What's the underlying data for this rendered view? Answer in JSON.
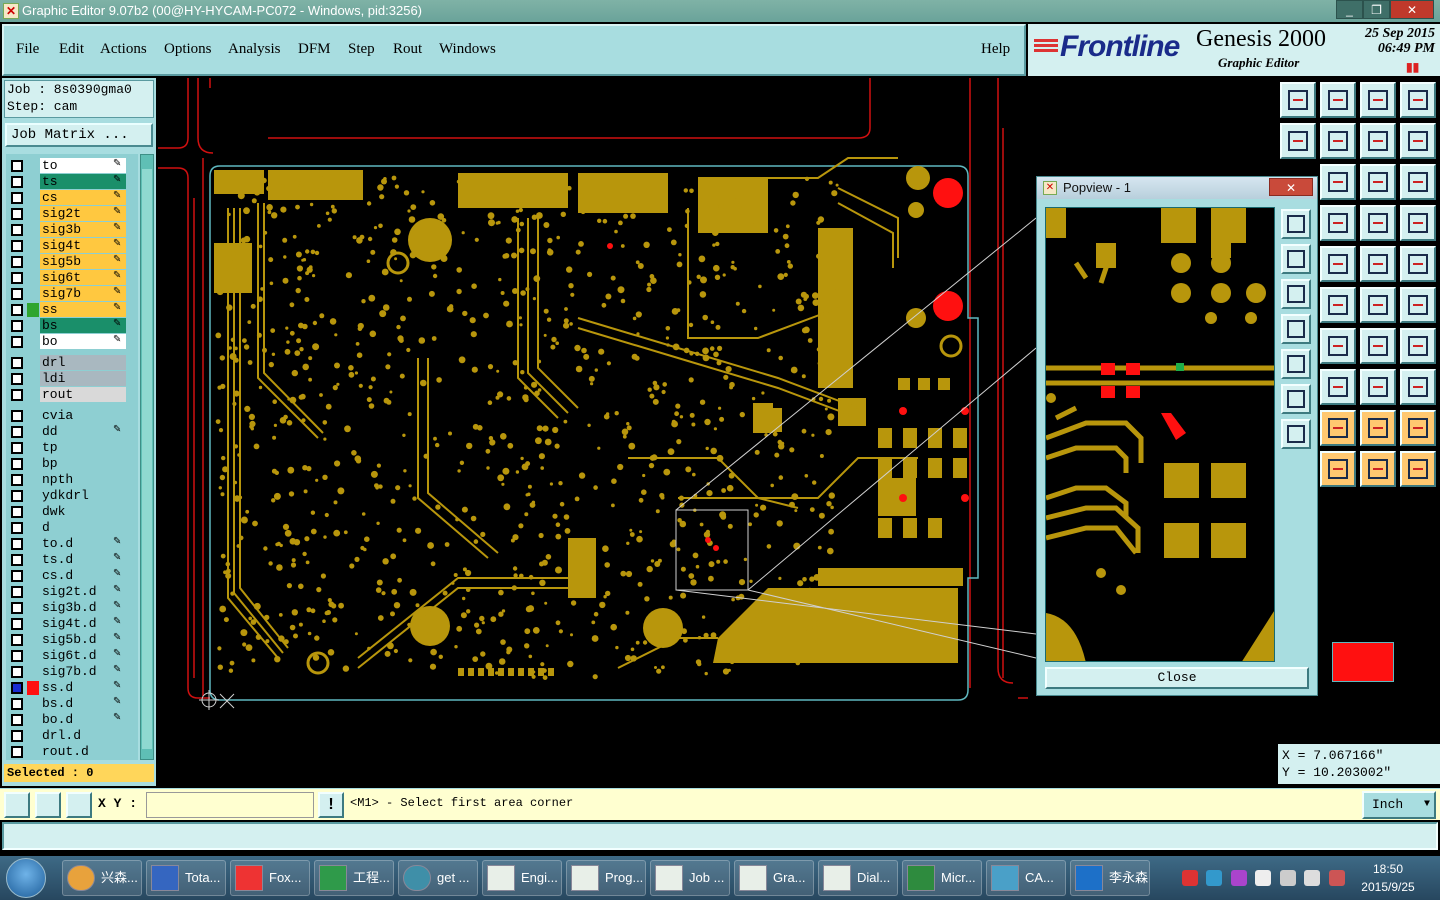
{
  "window": {
    "title": "Graphic Editor 9.07b2 (00@HY-HYCAM-PC072 - Windows, pid:3256)"
  },
  "menu": {
    "file": "File",
    "edit": "Edit",
    "actions": "Actions",
    "options": "Options",
    "analysis": "Analysis",
    "dfm": "DFM",
    "step": "Step",
    "rout": "Rout",
    "windows": "Windows",
    "help": "Help"
  },
  "branding": {
    "logo": "Frontline",
    "product": "Genesis 2000",
    "subtitle": "Graphic Editor",
    "date_line1": "25 Sep 2015",
    "date_line2": "06:49 PM"
  },
  "job": {
    "job_line": "Job : 8s0390gma0",
    "step_line": "Step: cam",
    "matrix_button": "Job Matrix ..."
  },
  "layers": [
    {
      "name": "to",
      "color": "#ffffff",
      "editable": true
    },
    {
      "name": "ts",
      "color": "#1a8f6a",
      "editable": true
    },
    {
      "name": "cs",
      "color": "#ffc840",
      "editable": true
    },
    {
      "name": "sig2t",
      "color": "#ffc840",
      "editable": true
    },
    {
      "name": "sig3b",
      "color": "#ffc840",
      "editable": true
    },
    {
      "name": "sig4t",
      "color": "#ffc840",
      "editable": true
    },
    {
      "name": "sig5b",
      "color": "#ffc840",
      "editable": true
    },
    {
      "name": "sig6t",
      "color": "#ffc840",
      "editable": true
    },
    {
      "name": "sig7b",
      "color": "#ffc840",
      "editable": true
    },
    {
      "name": "ss",
      "color": "#ffc840",
      "editable": true
    },
    {
      "name": "bs",
      "color": "#1a8f6a",
      "editable": true
    },
    {
      "name": "bo",
      "color": "#ffffff",
      "editable": true
    },
    {
      "name": "drl",
      "color": "#a9b8c0",
      "editable": false
    },
    {
      "name": "ldi",
      "color": "#a9b8c0",
      "editable": false
    },
    {
      "name": "rout",
      "color": "#d9d9d9",
      "editable": false
    },
    {
      "name": "cvia",
      "color": "#8ecfd2",
      "editable": false
    },
    {
      "name": "dd",
      "color": "#8ecfd2",
      "editable": true
    },
    {
      "name": "tp",
      "color": "#8ecfd2",
      "editable": false
    },
    {
      "name": "bp",
      "color": "#8ecfd2",
      "editable": false
    },
    {
      "name": "npth",
      "color": "#8ecfd2",
      "editable": false
    },
    {
      "name": "ydkdrl",
      "color": "#8ecfd2",
      "editable": false
    },
    {
      "name": "dwk",
      "color": "#8ecfd2",
      "editable": false
    },
    {
      "name": "d",
      "color": "#8ecfd2",
      "editable": false
    },
    {
      "name": "to.d",
      "color": "#8ecfd2",
      "editable": true
    },
    {
      "name": "ts.d",
      "color": "#8ecfd2",
      "editable": true
    },
    {
      "name": "cs.d",
      "color": "#8ecfd2",
      "editable": true
    },
    {
      "name": "sig2t.d",
      "color": "#8ecfd2",
      "editable": true
    },
    {
      "name": "sig3b.d",
      "color": "#8ecfd2",
      "editable": true
    },
    {
      "name": "sig4t.d",
      "color": "#8ecfd2",
      "editable": true
    },
    {
      "name": "sig5b.d",
      "color": "#8ecfd2",
      "editable": true
    },
    {
      "name": "sig6t.d",
      "color": "#8ecfd2",
      "editable": true
    },
    {
      "name": "sig7b.d",
      "color": "#8ecfd2",
      "editable": true
    },
    {
      "name": "ss.d",
      "color": "#8ecfd2",
      "editable": true
    },
    {
      "name": "bs.d",
      "color": "#8ecfd2",
      "editable": true
    },
    {
      "name": "bo.d",
      "color": "#8ecfd2",
      "editable": true
    },
    {
      "name": "drl.d",
      "color": "#8ecfd2",
      "editable": false
    },
    {
      "name": "rout.d",
      "color": "#8ecfd2",
      "editable": false
    }
  ],
  "selected_text": "Selected : 0",
  "popview": {
    "title": "Popview - 1",
    "close_label": "Close"
  },
  "coords": {
    "x": "X = 7.067166\"",
    "y": "Y = 10.203002\""
  },
  "status": {
    "xy_label": "X Y :",
    "xy_value": "",
    "prompt": "<M1> - Select first area corner",
    "unit": "Inch"
  },
  "taskbar": {
    "items": [
      "兴森...",
      "Tota...",
      "Fox...",
      "工程...",
      "get ...",
      "Engi...",
      "Prog...",
      "Job ...",
      "Gra...",
      "Dial...",
      "Micr...",
      "CA...",
      "李永森"
    ],
    "clock_time": "18:50",
    "clock_date": "2015/9/25"
  },
  "colors": {
    "copper": "#b8960c",
    "profile": "#5fb8c0",
    "pad_red": "#ff1010",
    "ui_bg": "#a8dde0"
  }
}
